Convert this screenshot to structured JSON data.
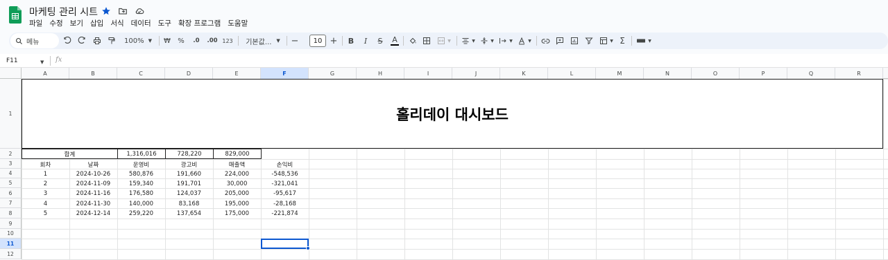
{
  "app": {
    "title": "마케팅 관리 시트",
    "menu": [
      "파일",
      "수정",
      "보기",
      "삽입",
      "서식",
      "데이터",
      "도구",
      "확장 프로그램",
      "도움말"
    ]
  },
  "toolbar": {
    "search_label": "메뉴",
    "zoom": "100%",
    "currency": "₩",
    "percent": "%",
    "dec_decrease": ".0",
    "dec_increase": ".00",
    "number_format": "123",
    "font_name": "기본값...",
    "font_size": "10",
    "minus": "−",
    "plus": "+",
    "bold": "B",
    "italic": "I",
    "strike": "S",
    "text_color": "A",
    "sigma": "Σ"
  },
  "formula_bar": {
    "name_box": "F11",
    "fx": "fx"
  },
  "grid": {
    "columns": [
      "A",
      "B",
      "C",
      "D",
      "E",
      "F",
      "G",
      "H",
      "I",
      "J",
      "K",
      "L",
      "M",
      "N",
      "O",
      "P",
      "Q",
      "R"
    ],
    "selected_column": "F",
    "rows": [
      "1",
      "2",
      "3",
      "4",
      "5",
      "6",
      "7",
      "8",
      "9",
      "10",
      "11",
      "12"
    ],
    "selected_row": "11",
    "title_cell": "홀리데이 대시보드",
    "totals": {
      "label": "합계",
      "operating": "1,316,016",
      "ad": "728,220",
      "sales": "829,000"
    },
    "headers": [
      "회차",
      "날짜",
      "운영비",
      "광고비",
      "매출액",
      "손익비"
    ],
    "data": [
      [
        "1",
        "2024-10-26",
        "580,876",
        "191,660",
        "224,000",
        "-548,536"
      ],
      [
        "2",
        "2024-11-09",
        "159,340",
        "191,701",
        "30,000",
        "-321,041"
      ],
      [
        "3",
        "2024-11-16",
        "176,580",
        "124,037",
        "205,000",
        "-95,617"
      ],
      [
        "4",
        "2024-11-30",
        "140,000",
        "83,168",
        "195,000",
        "-28,168"
      ],
      [
        "5",
        "2024-12-14",
        "259,220",
        "137,654",
        "175,000",
        "-221,874"
      ]
    ]
  }
}
